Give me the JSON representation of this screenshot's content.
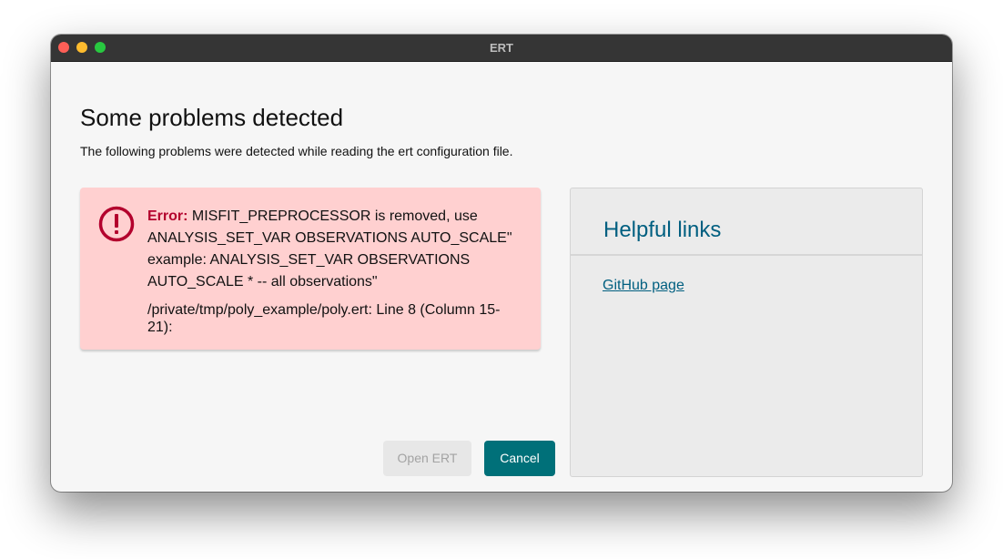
{
  "window": {
    "title": "ERT"
  },
  "dialog": {
    "heading": "Some problems detected",
    "subheading": "The following problems were detected while reading the ert configuration file."
  },
  "error": {
    "icon": "exclamation-circle-icon",
    "label": "Error:",
    "message": "MISFIT_PREPROCESSOR is removed, use ANALYSIS_SET_VAR OBSERVATIONS AUTO_SCALE\" example: ANALYSIS_SET_VAR OBSERVATIONS AUTO_SCALE * -- all observations\"",
    "location": "/private/tmp/poly_example/poly.ert: Line 8 (Column 15-21):"
  },
  "buttons": {
    "open_label": "Open ERT",
    "cancel_label": "Cancel"
  },
  "helpful_links": {
    "title": "Helpful links",
    "links": [
      {
        "label": "GitHub page"
      }
    ]
  },
  "colors": {
    "error_background": "#ffd0d0",
    "error_accent": "#b3002d",
    "primary_button": "#007079",
    "link": "#005f80"
  }
}
